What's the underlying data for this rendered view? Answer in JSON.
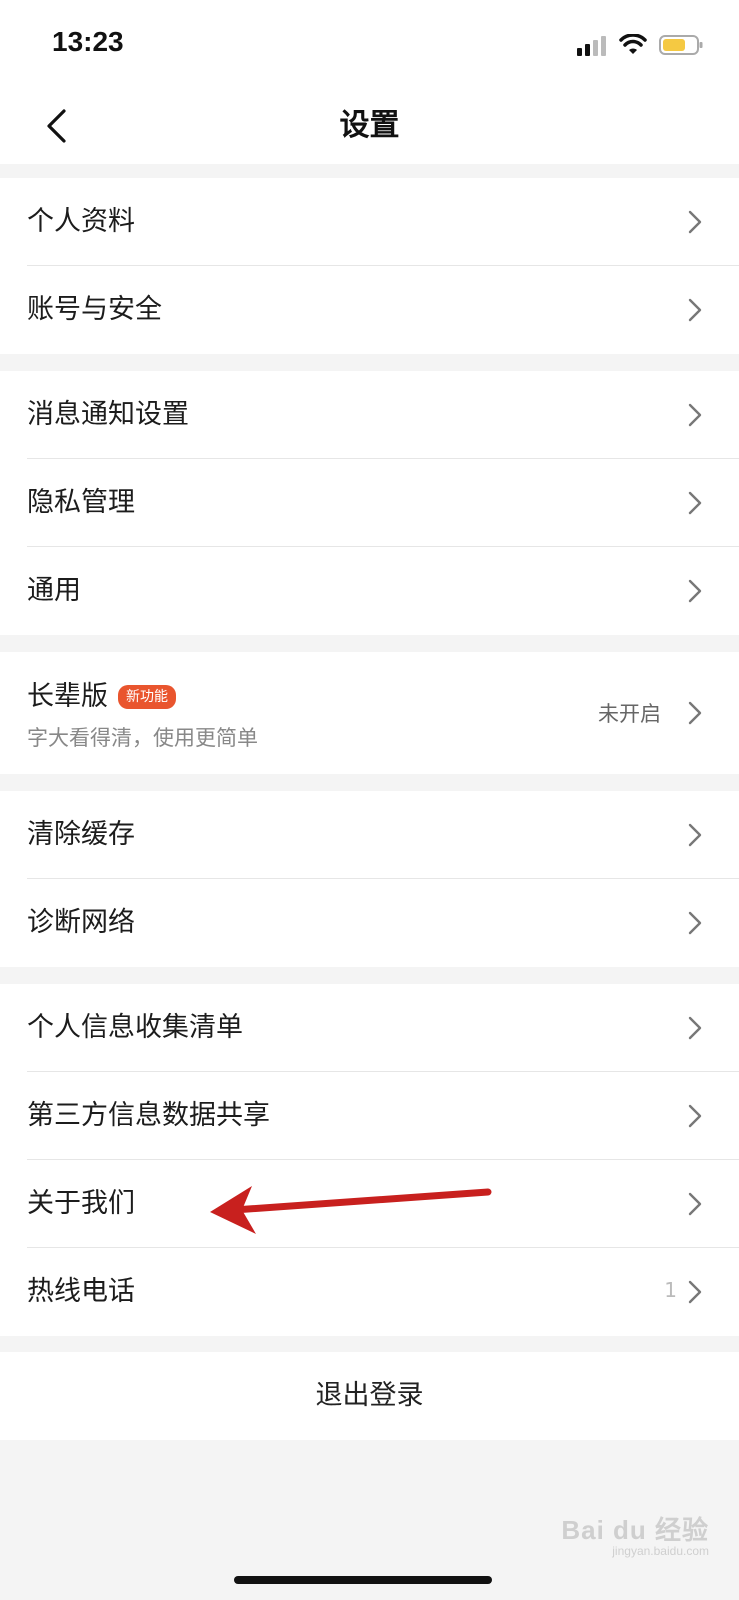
{
  "status_bar": {
    "time": "13:23"
  },
  "nav": {
    "title": "设置"
  },
  "groups": [
    {
      "items": [
        {
          "label": "个人资料"
        },
        {
          "label": "账号与安全"
        }
      ]
    },
    {
      "items": [
        {
          "label": "消息通知设置"
        },
        {
          "label": "隐私管理"
        },
        {
          "label": "通用"
        }
      ]
    },
    {
      "elder": {
        "label": "长辈版",
        "badge": "新功能",
        "subtitle": "字大看得清，使用更简单",
        "status": "未开启"
      }
    },
    {
      "items": [
        {
          "label": "清除缓存"
        },
        {
          "label": "诊断网络"
        }
      ]
    },
    {
      "items": [
        {
          "label": "个人信息收集清单"
        },
        {
          "label": "第三方信息数据共享"
        },
        {
          "label": "关于我们"
        },
        {
          "label": "热线电话",
          "hint": "1"
        }
      ]
    }
  ],
  "logout": {
    "label": "退出登录"
  },
  "watermark": {
    "text": "Bai du 经验",
    "sub": "jingyan.baidu.com"
  },
  "colors": {
    "badge": "#e9552e",
    "arrow": "#c8201e"
  }
}
